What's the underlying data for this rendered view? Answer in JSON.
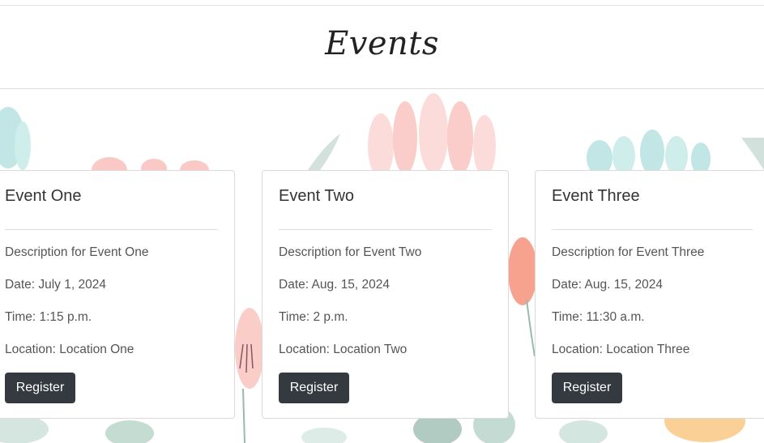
{
  "header": {
    "title": "Events"
  },
  "events": [
    {
      "title": "Event One",
      "description": "Description for Event One",
      "date": "Date: July 1, 2024",
      "time": "Time: 1:15 p.m.",
      "location": "Location: Location One",
      "button_label": "Register"
    },
    {
      "title": "Event Two",
      "description": "Description for Event Two",
      "date": "Date: Aug. 15, 2024",
      "time": "Time: 2 p.m.",
      "location": "Location: Location Two",
      "button_label": "Register"
    },
    {
      "title": "Event Three",
      "description": "Description for Event Three",
      "date": "Date: Aug. 15, 2024",
      "time": "Time: 11:30 a.m.",
      "location": "Location: Location Three",
      "button_label": "Register"
    }
  ],
  "colors": {
    "button_bg": "#343a40",
    "accent_pink": "#f7a6a0",
    "accent_teal": "#8fd3d1",
    "accent_orange": "#f9c073",
    "leaf_green": "#7fa99b"
  }
}
